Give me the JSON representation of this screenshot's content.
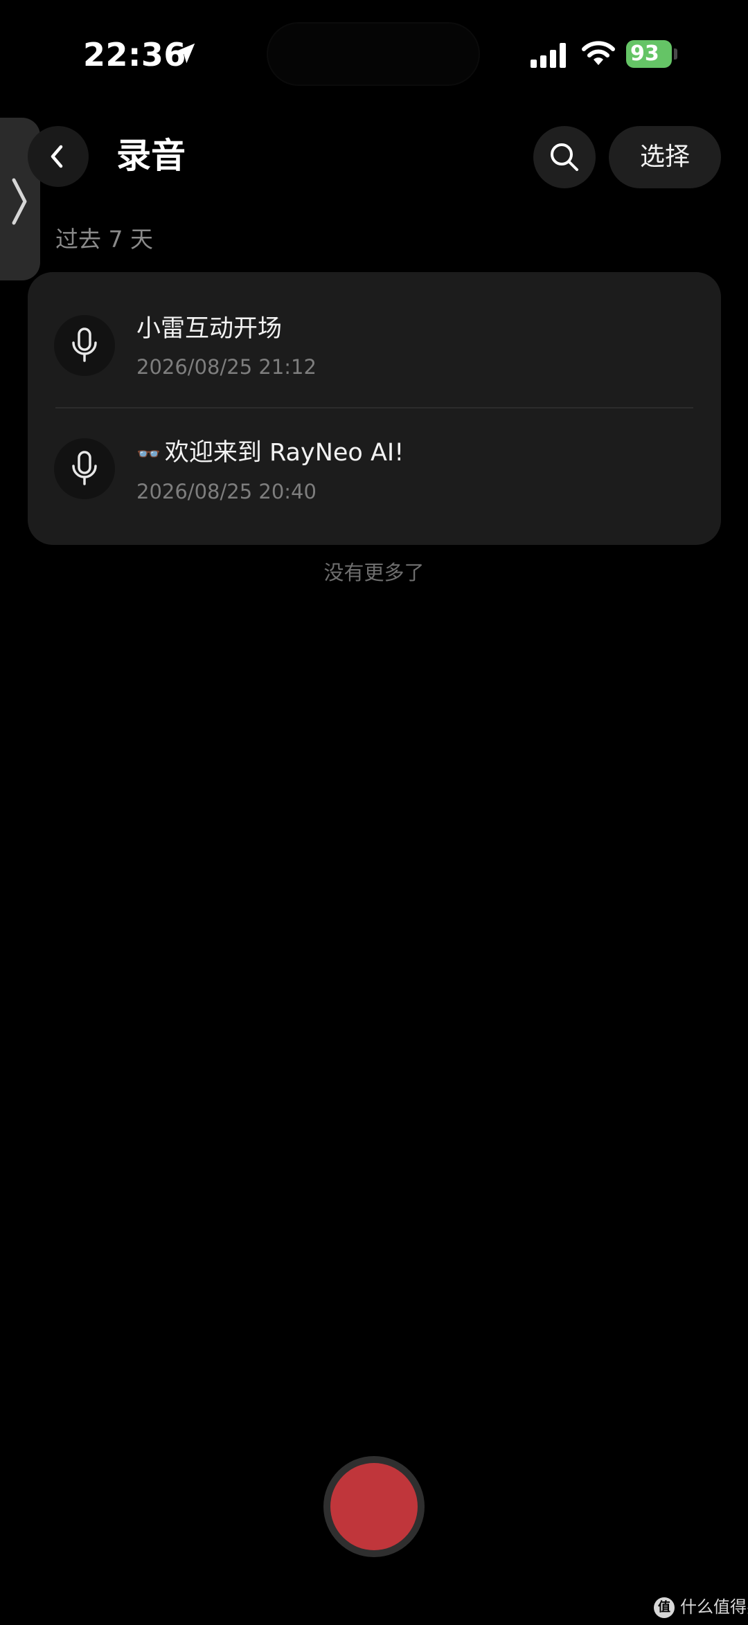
{
  "status_bar": {
    "time": "22:36",
    "battery_level": "93",
    "battery_color": "#65c466"
  },
  "header": {
    "title": "录音",
    "select_label": "选择"
  },
  "section": {
    "label": "过去 7 天"
  },
  "recordings": [
    {
      "title": "小雷互动开场",
      "timestamp": "2026/08/25 21:12",
      "icon": "microphone-icon"
    },
    {
      "emoji": "👓",
      "title": "欢迎来到 RayNeo AI!",
      "timestamp": "2026/08/25 20:40",
      "icon": "microphone-icon"
    }
  ],
  "end_note": "没有更多了",
  "record_button": {
    "color": "#c0363b"
  },
  "watermark": {
    "text": "什么值得买",
    "logo": "值"
  }
}
